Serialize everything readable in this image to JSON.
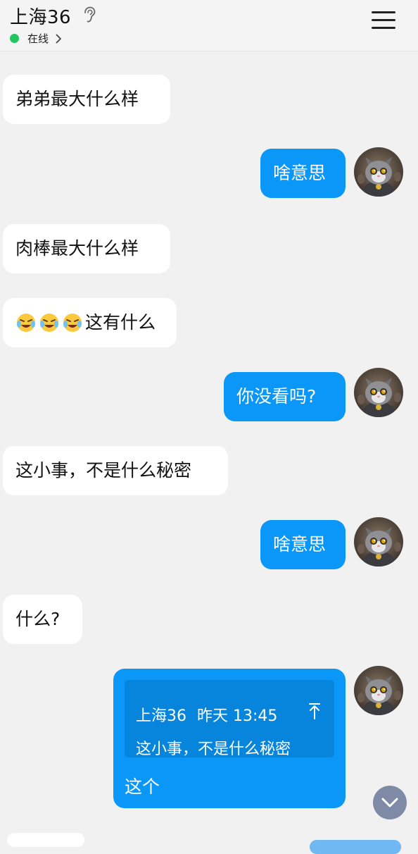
{
  "header": {
    "title": "上海36",
    "status": "在线"
  },
  "messages": [
    {
      "side": "in",
      "text": "弟弟最大什么样"
    },
    {
      "side": "out",
      "text": "啥意思"
    },
    {
      "side": "in",
      "text": "肉棒最大什么样"
    },
    {
      "side": "in",
      "text": "这有什么",
      "emoji_count": 3,
      "emoji": "crying-laughing-emoji"
    },
    {
      "side": "out",
      "text": "你没看吗?"
    },
    {
      "side": "in",
      "text": "这小事，不是什么秘密"
    },
    {
      "side": "out",
      "text": "啥意思"
    },
    {
      "side": "in",
      "text": "什么?"
    }
  ],
  "reply": {
    "quote_sender": "上海36",
    "quote_time": "昨天 13:45",
    "quote_text": "这小事，不是什么秘密",
    "text": "这个"
  },
  "colors": {
    "accent": "#0a97f8",
    "online": "#22c55e"
  }
}
